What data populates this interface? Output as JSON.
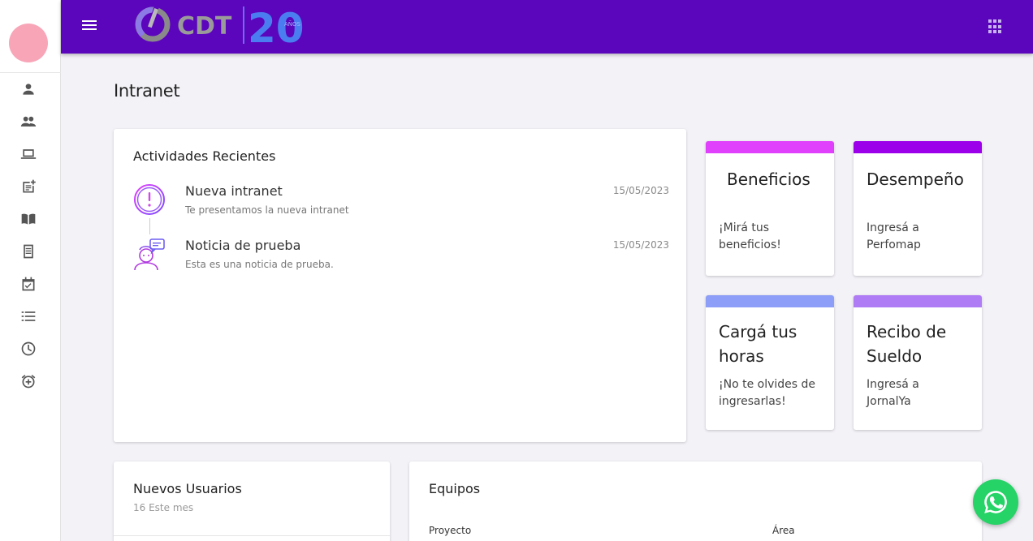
{
  "header": {
    "logo_text": "CDT",
    "logo_years": "20",
    "logo_sub": "AÑOS"
  },
  "sidebar": {
    "items": [
      {
        "icon": "person-icon"
      },
      {
        "icon": "people-icon"
      },
      {
        "icon": "laptop-icon"
      },
      {
        "icon": "post-add-icon"
      },
      {
        "icon": "book-icon"
      },
      {
        "icon": "receipt-icon"
      },
      {
        "icon": "event-available-icon"
      },
      {
        "icon": "list-icon"
      },
      {
        "icon": "clock-icon"
      },
      {
        "icon": "alarm-add-icon"
      }
    ]
  },
  "page": {
    "title": "Intranet"
  },
  "activities": {
    "title": "Actividades Recientes",
    "items": [
      {
        "title": "Nueva intranet",
        "subtitle": "Te presentamos la nueva intranet",
        "date": "15/05/2023",
        "icon": "alert-circle-icon"
      },
      {
        "title": "Noticia de prueba",
        "subtitle": "Esta es una noticia de prueba.",
        "date": "15/05/2023",
        "icon": "person-chat-icon"
      }
    ]
  },
  "quick_cards": [
    {
      "title": "Beneficios",
      "subtitle": "¡Mirá tus beneficios!",
      "color": "#e040fb"
    },
    {
      "title": "Desempeño",
      "subtitle": "Ingresá a Perfomap",
      "color": "#9c00ea"
    },
    {
      "title": "Cargá tus horas",
      "subtitle": "¡No te olvides de ingresarlas!",
      "color": "#8c9ef7"
    },
    {
      "title": "Recibo de Sueldo",
      "subtitle": "Ingresá a JornalYa",
      "color": "#b07cf5"
    }
  ],
  "new_users": {
    "title": "Nuevos Usuarios",
    "subtitle": "16 Este mes"
  },
  "teams": {
    "title": "Equipos",
    "columns": [
      "Proyecto",
      "Área"
    ]
  },
  "colors": {
    "topbar": "#5b05bd",
    "whatsapp": "#25d366"
  }
}
